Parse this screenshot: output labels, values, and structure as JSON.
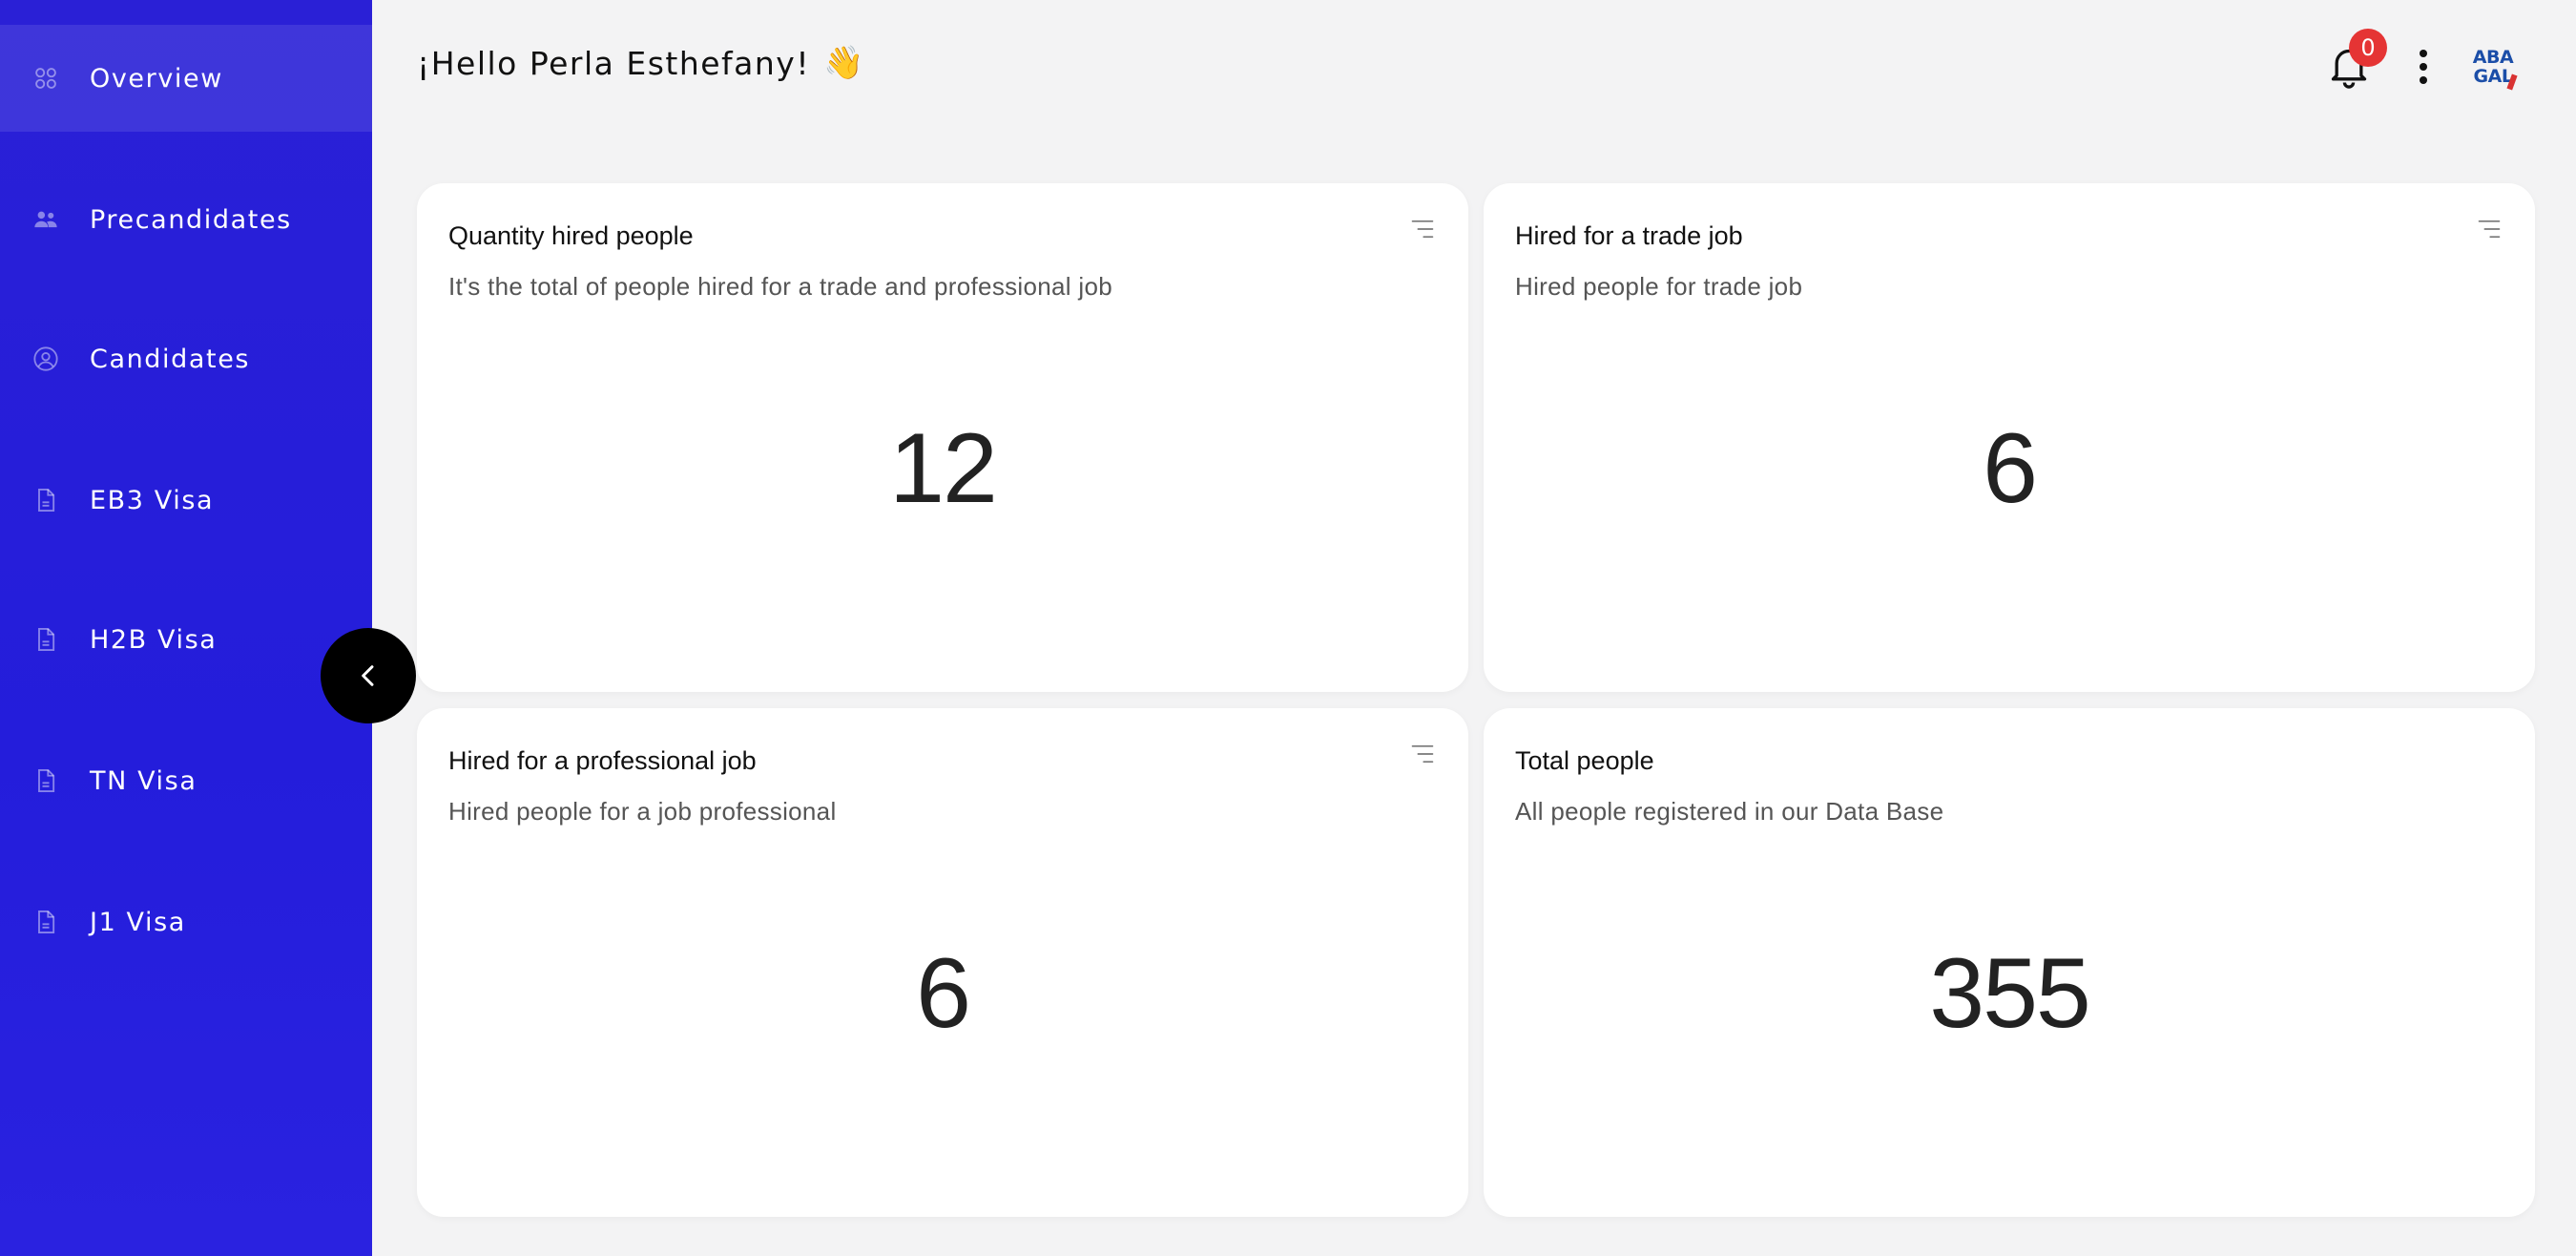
{
  "sidebar": {
    "items": [
      {
        "label": "Overview",
        "icon": "grid-icon",
        "active": true
      },
      {
        "label": "Precandidates",
        "icon": "users-icon",
        "active": false
      },
      {
        "label": "Candidates",
        "icon": "user-circle-icon",
        "active": false
      },
      {
        "label": "EB3 Visa",
        "icon": "document-icon",
        "active": false
      },
      {
        "label": "H2B Visa",
        "icon": "document-icon",
        "active": false
      },
      {
        "label": "TN Visa",
        "icon": "document-icon",
        "active": false
      },
      {
        "label": "J1 Visa",
        "icon": "document-icon",
        "active": false
      }
    ],
    "collapse_icon": "chevron-left-icon"
  },
  "header": {
    "greeting": "¡Hello Perla Esthefany!",
    "greeting_emoji": "👋",
    "notifications_count": "0",
    "logo_lines": [
      "ABA",
      "GAL"
    ]
  },
  "cards": [
    {
      "title": "Quantity hired people",
      "subtitle": "It's the total of people hired for a trade and professional job",
      "value": "12",
      "has_filter": true
    },
    {
      "title": "Hired for a trade job",
      "subtitle": "Hired people for trade job",
      "value": "6",
      "has_filter": true
    },
    {
      "title": "Hired for a professional job",
      "subtitle": "Hired people for a job professional",
      "value": "6",
      "has_filter": true
    },
    {
      "title": "Total people",
      "subtitle": "All people registered in our Data Base",
      "value": "355",
      "has_filter": false
    }
  ],
  "colors": {
    "sidebar": "#241ddb",
    "badge": "#e53434",
    "background": "#f3f3f4"
  }
}
